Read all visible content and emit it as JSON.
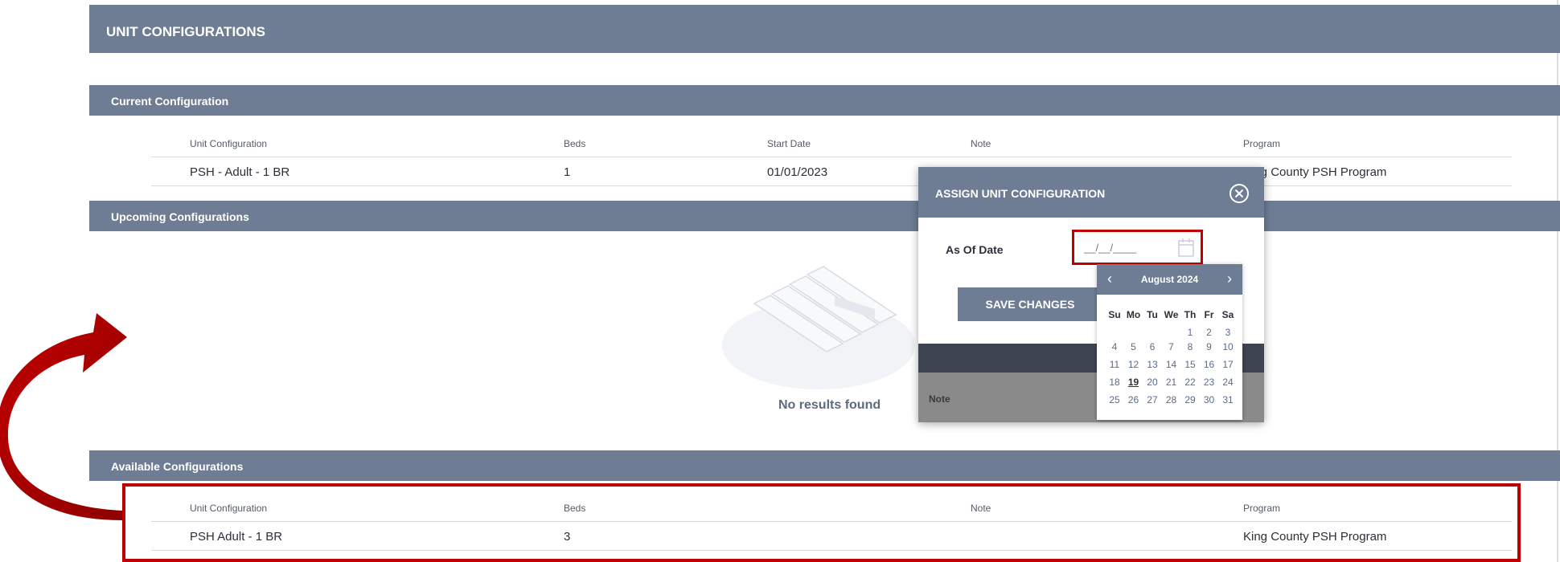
{
  "header": {
    "title": "UNIT CONFIGURATIONS"
  },
  "current": {
    "title": "Current Configuration",
    "columns": [
      "Unit Configuration",
      "Beds",
      "Start Date",
      "Note",
      "Program"
    ],
    "row": {
      "unit": "PSH - Adult - 1 BR",
      "beds": "1",
      "start_date": "01/01/2023",
      "note": "",
      "program": "King County PSH Program"
    }
  },
  "upcoming": {
    "title": "Upcoming Configurations",
    "empty_text": "No results found"
  },
  "available": {
    "title": "Available Configurations",
    "columns": [
      "Unit Configuration",
      "Beds",
      "Note",
      "Program"
    ],
    "row": {
      "unit": "PSH Adult - 1 BR",
      "beds": "3",
      "note": "",
      "program": "King County PSH Program"
    }
  },
  "modal": {
    "title": "ASSIGN UNIT CONFIGURATION",
    "as_of_label": "As Of Date",
    "date_placeholder": "__/__/____",
    "save_label": "SAVE CHANGES",
    "note_label": "Note"
  },
  "calendar": {
    "month_label": "August 2024",
    "prev": "‹",
    "next": "›",
    "weekdays": [
      "Su",
      "Mo",
      "Tu",
      "We",
      "Th",
      "Fr",
      "Sa"
    ],
    "weeks": [
      [
        "",
        "",
        "",
        "",
        "1",
        "2",
        "3"
      ],
      [
        "4",
        "5",
        "6",
        "7",
        "8",
        "9",
        "10"
      ],
      [
        "11",
        "12",
        "13",
        "14",
        "15",
        "16",
        "17"
      ],
      [
        "18",
        "19",
        "20",
        "21",
        "22",
        "23",
        "24"
      ],
      [
        "25",
        "26",
        "27",
        "28",
        "29",
        "30",
        "31"
      ]
    ],
    "today": "19"
  },
  "colors": {
    "bar": "#6e7d94",
    "highlight": "#c00000",
    "arrow": "#b00000"
  }
}
